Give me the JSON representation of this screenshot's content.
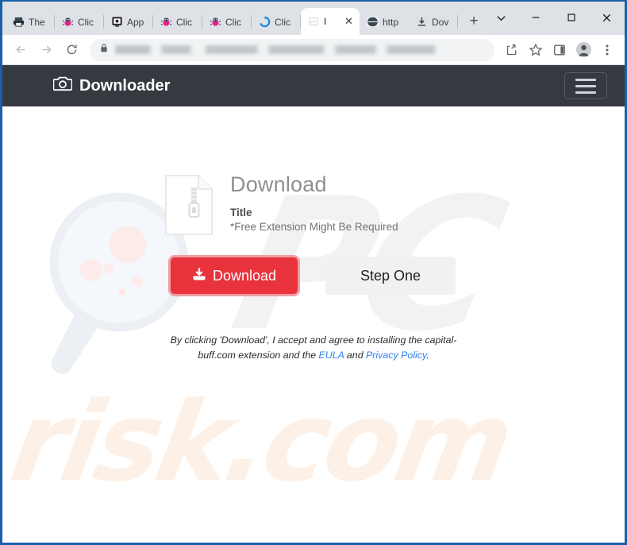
{
  "browser": {
    "tabs": [
      {
        "label": "The",
        "icon": "printer-favicon",
        "active": false
      },
      {
        "label": "Clic",
        "icon": "bug-favicon",
        "active": false
      },
      {
        "label": "App",
        "icon": "monitor-favicon",
        "active": false
      },
      {
        "label": "Clic",
        "icon": "bug-favicon",
        "active": false
      },
      {
        "label": "Clic",
        "icon": "bug-favicon",
        "active": false
      },
      {
        "label": "Clic",
        "icon": "refresh-favicon",
        "active": false
      },
      {
        "label": "I",
        "icon": "page-favicon",
        "active": true
      },
      {
        "label": "http",
        "icon": "globe-favicon",
        "active": false
      },
      {
        "label": "Dov",
        "icon": "download-favicon",
        "active": false
      }
    ],
    "new_tab_label": "+",
    "window_controls": {
      "tab_search": "⌄",
      "minimize": "–",
      "maximize": "□",
      "close": "✕"
    },
    "toolbar": {
      "back": "back-arrow",
      "forward": "forward-arrow",
      "reload": "reload",
      "lock": "lock-icon",
      "url_value": "",
      "url_placeholder": "",
      "share": "share-icon",
      "bookmark": "star-icon",
      "side_panel": "side-panel-icon",
      "profile": "profile-avatar",
      "menu": "three-dot-menu"
    }
  },
  "site": {
    "header": {
      "brand": "Downloader",
      "brand_icon": "camera-icon",
      "menu_button": "hamburger-menu"
    },
    "watermarks": {
      "logo": "PC",
      "domain": "risk.com"
    },
    "card": {
      "file_icon": "zip-file-icon",
      "title": "Download",
      "subtitle": "Title",
      "note": "*Free Extension Might Be Required",
      "download_button": "Download",
      "download_button_icon": "download-icon",
      "step_button": "Step One"
    },
    "disclaimer": {
      "text_before": "By clicking 'Download', I accept and agree to installing the capital-buff.com extension and the ",
      "link_eula": "EULA",
      "text_between": " and ",
      "link_privacy": "Privacy Policy",
      "text_after": "."
    },
    "colors": {
      "header_bg": "#343a40",
      "accent_red": "#e8323c",
      "link_blue": "#2d7ff0",
      "step_bg": "#f1f1f1",
      "window_frame": "#1b5ea9"
    }
  }
}
